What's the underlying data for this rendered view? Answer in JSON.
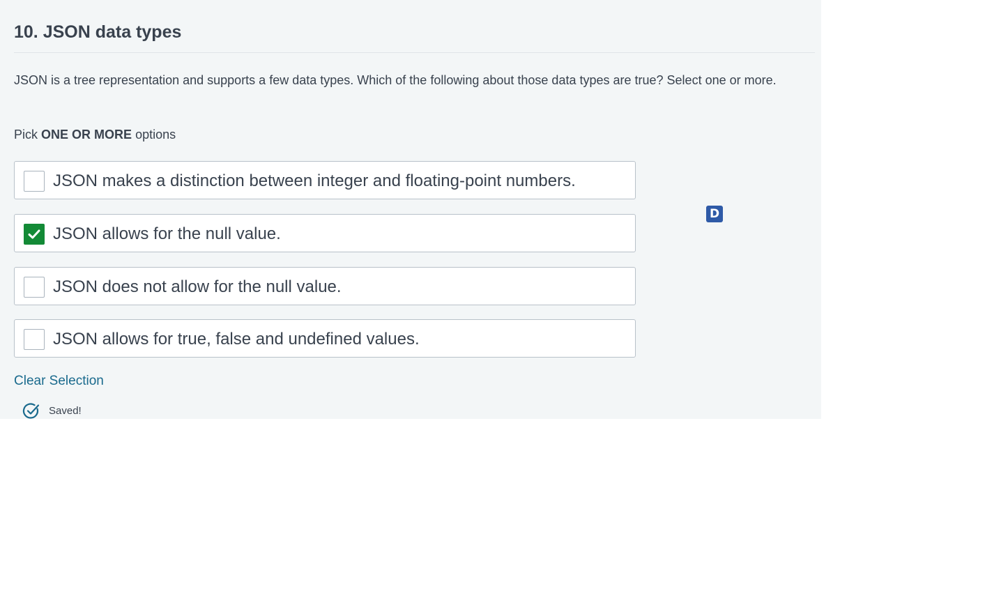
{
  "question": {
    "title": "10. JSON data types",
    "text": "JSON is a tree representation and supports a few data types. Which of the following about those data types are true?  Select one or more.",
    "pick_prefix": "Pick",
    "pick_emphasis": "ONE OR MORE",
    "pick_suffix": "options"
  },
  "options": [
    {
      "label": "JSON makes a distinction between integer and floating-point numbers.",
      "checked": false
    },
    {
      "label": "JSON allows for the null value.",
      "checked": true
    },
    {
      "label": "JSON does not allow for the null value.",
      "checked": false
    },
    {
      "label": "JSON allows for true, false and undefined values.",
      "checked": false
    }
  ],
  "badge": {
    "label": "D",
    "color": "#2e5aa7"
  },
  "actions": {
    "clear_label": "Clear Selection"
  },
  "status": {
    "saved_label": "Saved!",
    "icon": "check-circle-icon"
  },
  "colors": {
    "panel_background": "#f3f6f7",
    "checked": "#138a36",
    "link": "#1a6a8d",
    "text": "#39424e"
  }
}
